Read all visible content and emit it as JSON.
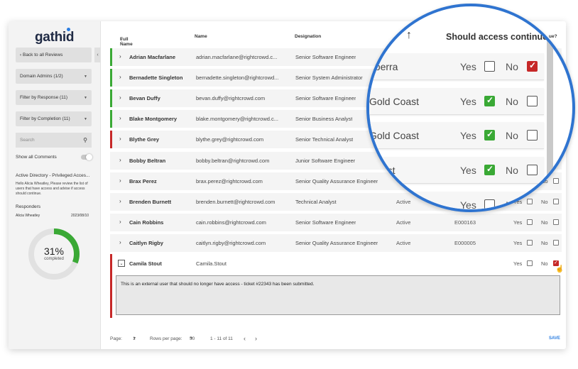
{
  "brand": {
    "name": "gathid",
    "accent": "#2a7de1"
  },
  "sidebar": {
    "back_label": "Back to all Reviews",
    "filters": [
      {
        "label": "Domain Admins (1/2)"
      },
      {
        "label": "Filter by Response (11)"
      },
      {
        "label": "Filter by Completion (11)"
      }
    ],
    "search_placeholder": "Search",
    "show_comments_label": "Show all Comments",
    "review_title": "Active Directory - Privileged Acces...",
    "review_desc": "Hello Alicia Wheatley, Please review the list of users that have access and advise if access should continue.",
    "responders_label": "Responders",
    "responder_name": "Alicia Wheatley",
    "responder_date": "2023/08/10",
    "progress": {
      "percent_label": "31%",
      "sub_label": "completed",
      "value": 0.31
    }
  },
  "table": {
    "headers": {
      "full_name": "Full Name",
      "name": "Name",
      "designation": "Designation",
      "continue": "ue?"
    },
    "rows": [
      {
        "full_name": "Adrian Macfarlane",
        "name": "adrian.macfarlane@rightcrowd.c...",
        "designation": "Senior Software Engineer",
        "status": "",
        "id": "",
        "yes": "Yes",
        "no": "No",
        "flag": "#3aa935",
        "choice": ""
      },
      {
        "full_name": "Bernadette Singleton",
        "name": "bernadette.singleton@rightcrowd...",
        "designation": "Senior System Administrator",
        "status": "",
        "id": "",
        "yes": "Yes",
        "no": "No",
        "flag": "#3aa935",
        "choice": ""
      },
      {
        "full_name": "Bevan Duffy",
        "name": "bevan.duffy@rightcrowd.com",
        "designation": "Senior Software Engineer",
        "status": "",
        "id": "",
        "yes": "Yes",
        "no": "No",
        "flag": "#3aa935",
        "choice": ""
      },
      {
        "full_name": "Blake Montgomery",
        "name": "blake.montgomery@rightcrowd.c...",
        "designation": "Senior Business Analyst",
        "status": "",
        "id": "",
        "yes": "Yes",
        "no": "No",
        "flag": "#3aa935",
        "choice": ""
      },
      {
        "full_name": "Blythe Grey",
        "name": "blythe.grey@rightcrowd.com",
        "designation": "Senior Technical Analyst",
        "status": "",
        "id": "",
        "yes": "Yes",
        "no": "No",
        "flag": "#c62828",
        "choice": ""
      },
      {
        "full_name": "Bobby Beltran",
        "name": "bobby.beltran@rightcrowd.com",
        "designation": "Junior Software Engineer",
        "status": "",
        "id": "",
        "yes": "Yes",
        "no": "No",
        "flag": "",
        "choice": ""
      },
      {
        "full_name": "Brax Perez",
        "name": "brax.perez@rightcrowd.com",
        "designation": "Senior Quality Assurance Engineer",
        "status": "",
        "id": "",
        "yes": "Yes",
        "no": "No",
        "flag": "",
        "choice": ""
      },
      {
        "full_name": "Brenden Burnett",
        "name": "brenden.burnett@rightcrowd.com",
        "designation": "Technical Analyst",
        "status": "Active",
        "id": "",
        "yes": "Yes",
        "no": "No",
        "flag": "",
        "choice": ""
      },
      {
        "full_name": "Cain Robbins",
        "name": "cain.robbins@rightcrowd.com",
        "designation": "Senior Software Engineer",
        "status": "Active",
        "id": "E000163",
        "yes": "Yes",
        "no": "No",
        "flag": "",
        "choice": ""
      },
      {
        "full_name": "Caitlyn Rigby",
        "name": "caitlyn.rigby@rightcrowd.com",
        "designation": "Senior Quality Assurance Engineer",
        "status": "Active",
        "id": "E000005",
        "yes": "Yes",
        "no": "No",
        "flag": "",
        "choice": ""
      }
    ],
    "expanded_row": {
      "full_name": "Camila Stout",
      "name": "Camila.Stout",
      "yes": "Yes",
      "no": "No",
      "choice": "no"
    },
    "comment": "This is an external user that should no longer have access - ticket #22343 has been submitted."
  },
  "footer": {
    "page_label": "Page:",
    "page_value": "1",
    "rows_label": "Rows per page:",
    "rows_value": "50",
    "range": "1 - 11 of 11",
    "prev": "‹",
    "next": "›",
    "save_label": "SAVE"
  },
  "magnifier": {
    "header": "Should access continue?",
    "rows": [
      {
        "location": "nberra",
        "yes": "Yes",
        "no": "No",
        "choice": "no"
      },
      {
        "location": "Gold Coast",
        "yes": "Yes",
        "no": "No",
        "choice": "yes"
      },
      {
        "location": "Gold Coast",
        "yes": "Yes",
        "no": "No",
        "choice": "yes"
      },
      {
        "location": "Coast",
        "yes": "Yes",
        "no": "No",
        "choice": "yes"
      },
      {
        "location": "",
        "yes": "Yes",
        "no": "No",
        "choice": ""
      }
    ]
  }
}
